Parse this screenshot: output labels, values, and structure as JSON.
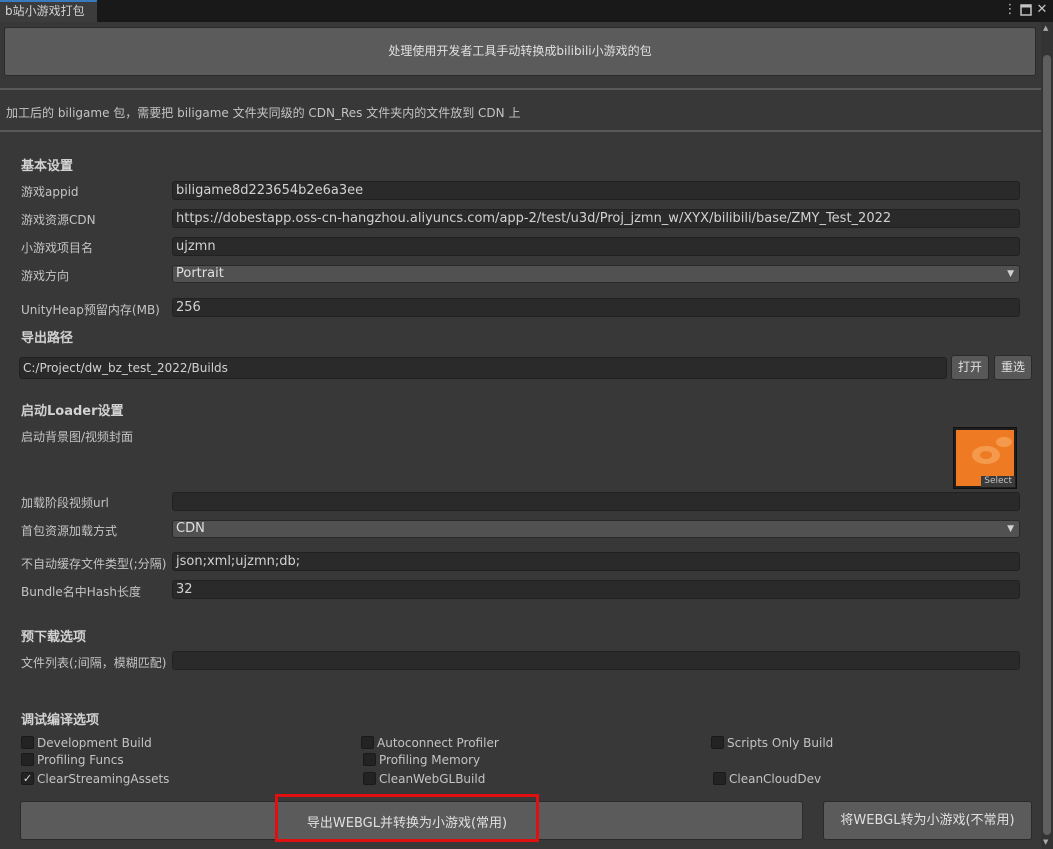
{
  "window": {
    "tab_title": "b站小游戏打包",
    "menu_icon": "kebab-menu-icon",
    "maximize_icon": "maximize-icon",
    "close_icon": "close-icon"
  },
  "top_button": "处理使用开发者工具手动转换成bilibili小游戏的包",
  "info_text": "加工后的 biligame 包，需要把 biligame 文件夹同级的 CDN_Res 文件夹内的文件放到 CDN 上",
  "basic": {
    "heading": "基本设置",
    "appid_label": "游戏appid",
    "appid_value": "biligame8d223654b2e6a3ee",
    "cdn_label": "游戏资源CDN",
    "cdn_value": "https://dobestapp.oss-cn-hangzhou.aliyuncs.com/app-2/test/u3d/Proj_jzmn_w/XYX/bilibili/base/ZMY_Test_2022",
    "project_label": "小游戏项目名",
    "project_value": "ujzmn",
    "orientation_label": "游戏方向",
    "orientation_value": "Portrait",
    "heap_label": "UnityHeap预留内存(MB)",
    "heap_value": "256"
  },
  "export": {
    "heading": "导出路径",
    "path_value": "C:/Project/dw_bz_test_2022/Builds",
    "open_label": "打开",
    "reselect_label": "重选"
  },
  "loader": {
    "heading": "启动Loader设置",
    "bg_label": "启动背景图/视频封面",
    "select_label": "Select",
    "video_label": "加载阶段视频url",
    "video_value": "",
    "load_mode_label": "首包资源加载方式",
    "load_mode_value": "CDN",
    "nocache_label": "不自动缓存文件类型(;分隔)",
    "nocache_value": "json;xml;ujzmn;db;",
    "hash_label": "Bundle名中Hash长度",
    "hash_value": "32"
  },
  "preload": {
    "heading": "预下载选项",
    "list_label": "文件列表(;间隔，模糊匹配)",
    "list_value": ""
  },
  "debug": {
    "heading": "调试编译选项",
    "options": [
      {
        "label": "Development Build",
        "checked": false
      },
      {
        "label": "Autoconnect Profiler",
        "checked": false
      },
      {
        "label": "Scripts Only Build",
        "checked": false
      },
      {
        "label": "Profiling Funcs",
        "checked": false
      },
      {
        "label": "Profiling Memory",
        "checked": false
      },
      {
        "label": "ClearStreamingAssets",
        "checked": true
      },
      {
        "label": "CleanWebGLBuild",
        "checked": false
      },
      {
        "label": "CleanCloudDev",
        "checked": false
      }
    ]
  },
  "actions": {
    "export_convert_label": "导出WEBGL并转换为小游戏(常用)",
    "convert_only_label": "将WEBGL转为小游戏(不常用)"
  },
  "colors": {
    "background": "#383838",
    "highlight_border": "#e01010",
    "tab_accent": "#3a79bb"
  }
}
